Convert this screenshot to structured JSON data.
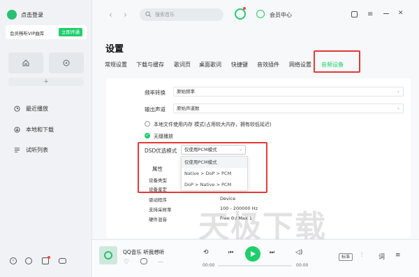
{
  "sidebar": {
    "login_text": "点击登录",
    "vip_text": "会员畅听VIP曲库",
    "vip_button": "立即开通",
    "add_symbol": "+",
    "items": [
      {
        "label": "最近播放",
        "icon": "clock-icon"
      },
      {
        "label": "本地和下载",
        "icon": "download-icon"
      },
      {
        "label": "试听列表",
        "icon": "list-icon"
      }
    ]
  },
  "header": {
    "search_placeholder": "搜索音乐",
    "member_center": "会员中心"
  },
  "settings": {
    "title": "设置",
    "tabs": [
      "常规设置",
      "下载与缓存",
      "歌词页",
      "桌面歌词",
      "快捷键",
      "音效插件",
      "网络设置",
      "音频设备"
    ],
    "active_tab": "音频设备",
    "sample_conv_label": "频率转换",
    "sample_conv_value": "原始频率",
    "output_channel_label": "输出声道",
    "output_channel_value": "原始声道数",
    "local_file_option": "本地文件使用内存 模式(占用较大内存，拥有较低延迟)",
    "gapless_option": "无缝播放",
    "dsd_label": "DSD优选模式",
    "dsd_value": "仅使用PCM模式",
    "dsd_options": [
      "仅使用PCM模式",
      "Native > DoP > PCM",
      "DoP > Native > PCM"
    ],
    "props_title": "属性",
    "props": [
      {
        "key": "设备类型",
        "value": ""
      },
      {
        "key": "设备鉴定",
        "value": ""
      },
      {
        "key": "驱动程序",
        "value": "Device"
      },
      {
        "key": "支持采样率",
        "value": "100 - 200000 Hz"
      },
      {
        "key": "硬件混音",
        "value": "Free 0 / Max 1"
      }
    ]
  },
  "player": {
    "song": "QQ音乐 听我想听",
    "time_current": "00:00",
    "time_total": "00:00",
    "quality": "标准"
  },
  "watermark": "天极下载",
  "colors": {
    "accent": "#1ecf6c",
    "highlight_box": "#e53935"
  }
}
